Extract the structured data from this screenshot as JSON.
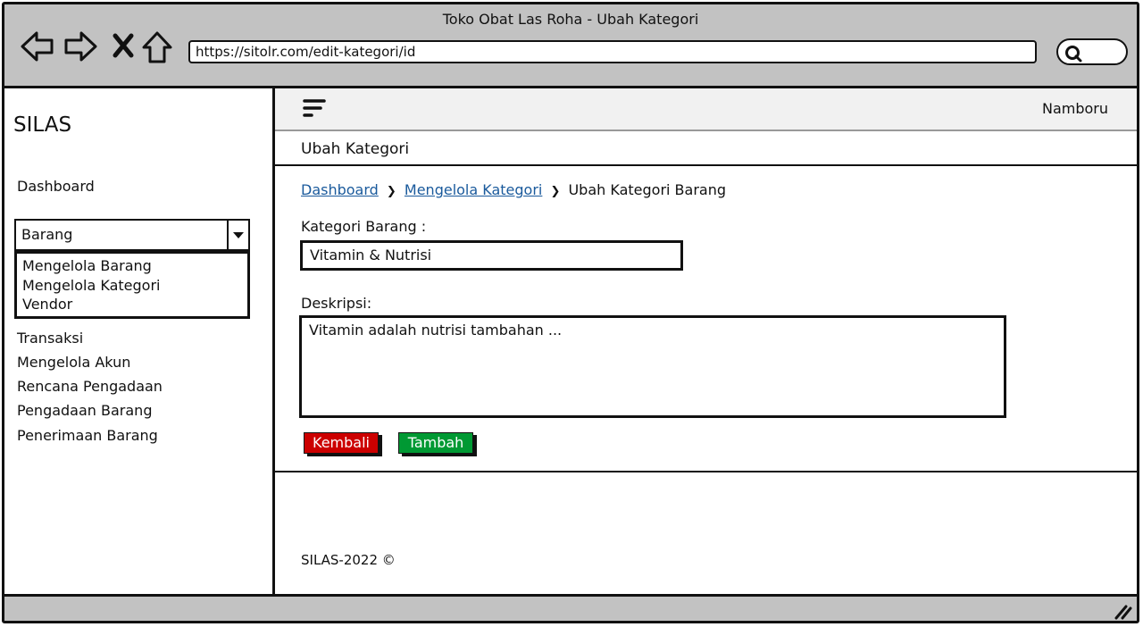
{
  "window": {
    "title": "Toko Obat Las Roha - Ubah Kategori",
    "url": "https://sitolr.com/edit-kategori/id"
  },
  "icons": {
    "back": "arrow-left-icon",
    "forward": "arrow-right-icon",
    "close": "close-icon",
    "home": "home-icon",
    "search": "search-icon",
    "menu": "hamburger-icon",
    "resize": "resize-grip-icon"
  },
  "sidebar": {
    "brand": "SILAS",
    "dashboard": "Dashboard",
    "select_value": "Barang",
    "select_options": [
      "Mengelola Barang",
      "Mengelola Kategori",
      "Vendor"
    ],
    "items": [
      "Transaksi",
      "Mengelola Akun",
      "Rencana Pengadaan",
      "Pengadaan Barang",
      "Penerimaan Barang"
    ]
  },
  "topbar": {
    "user": "Namboru"
  },
  "page": {
    "title": "Ubah Kategori",
    "breadcrumb": [
      "Dashboard",
      "Mengelola Kategori",
      "Ubah Kategori Barang"
    ]
  },
  "form": {
    "kategori_label": "Kategori Barang :",
    "kategori_value": "Vitamin  & Nutrisi",
    "deskripsi_label": "Deskripsi:",
    "deskripsi_value": "Vitamin adalah nutrisi tambahan ...",
    "back_button": "Kembali",
    "submit_button": "Tambah"
  },
  "colors": {
    "chrome": "#c2c2c2",
    "link": "#1a5a9c",
    "danger": "#cc0000",
    "success": "#009933"
  },
  "footer": {
    "text": "SILAS-2022 ©"
  }
}
